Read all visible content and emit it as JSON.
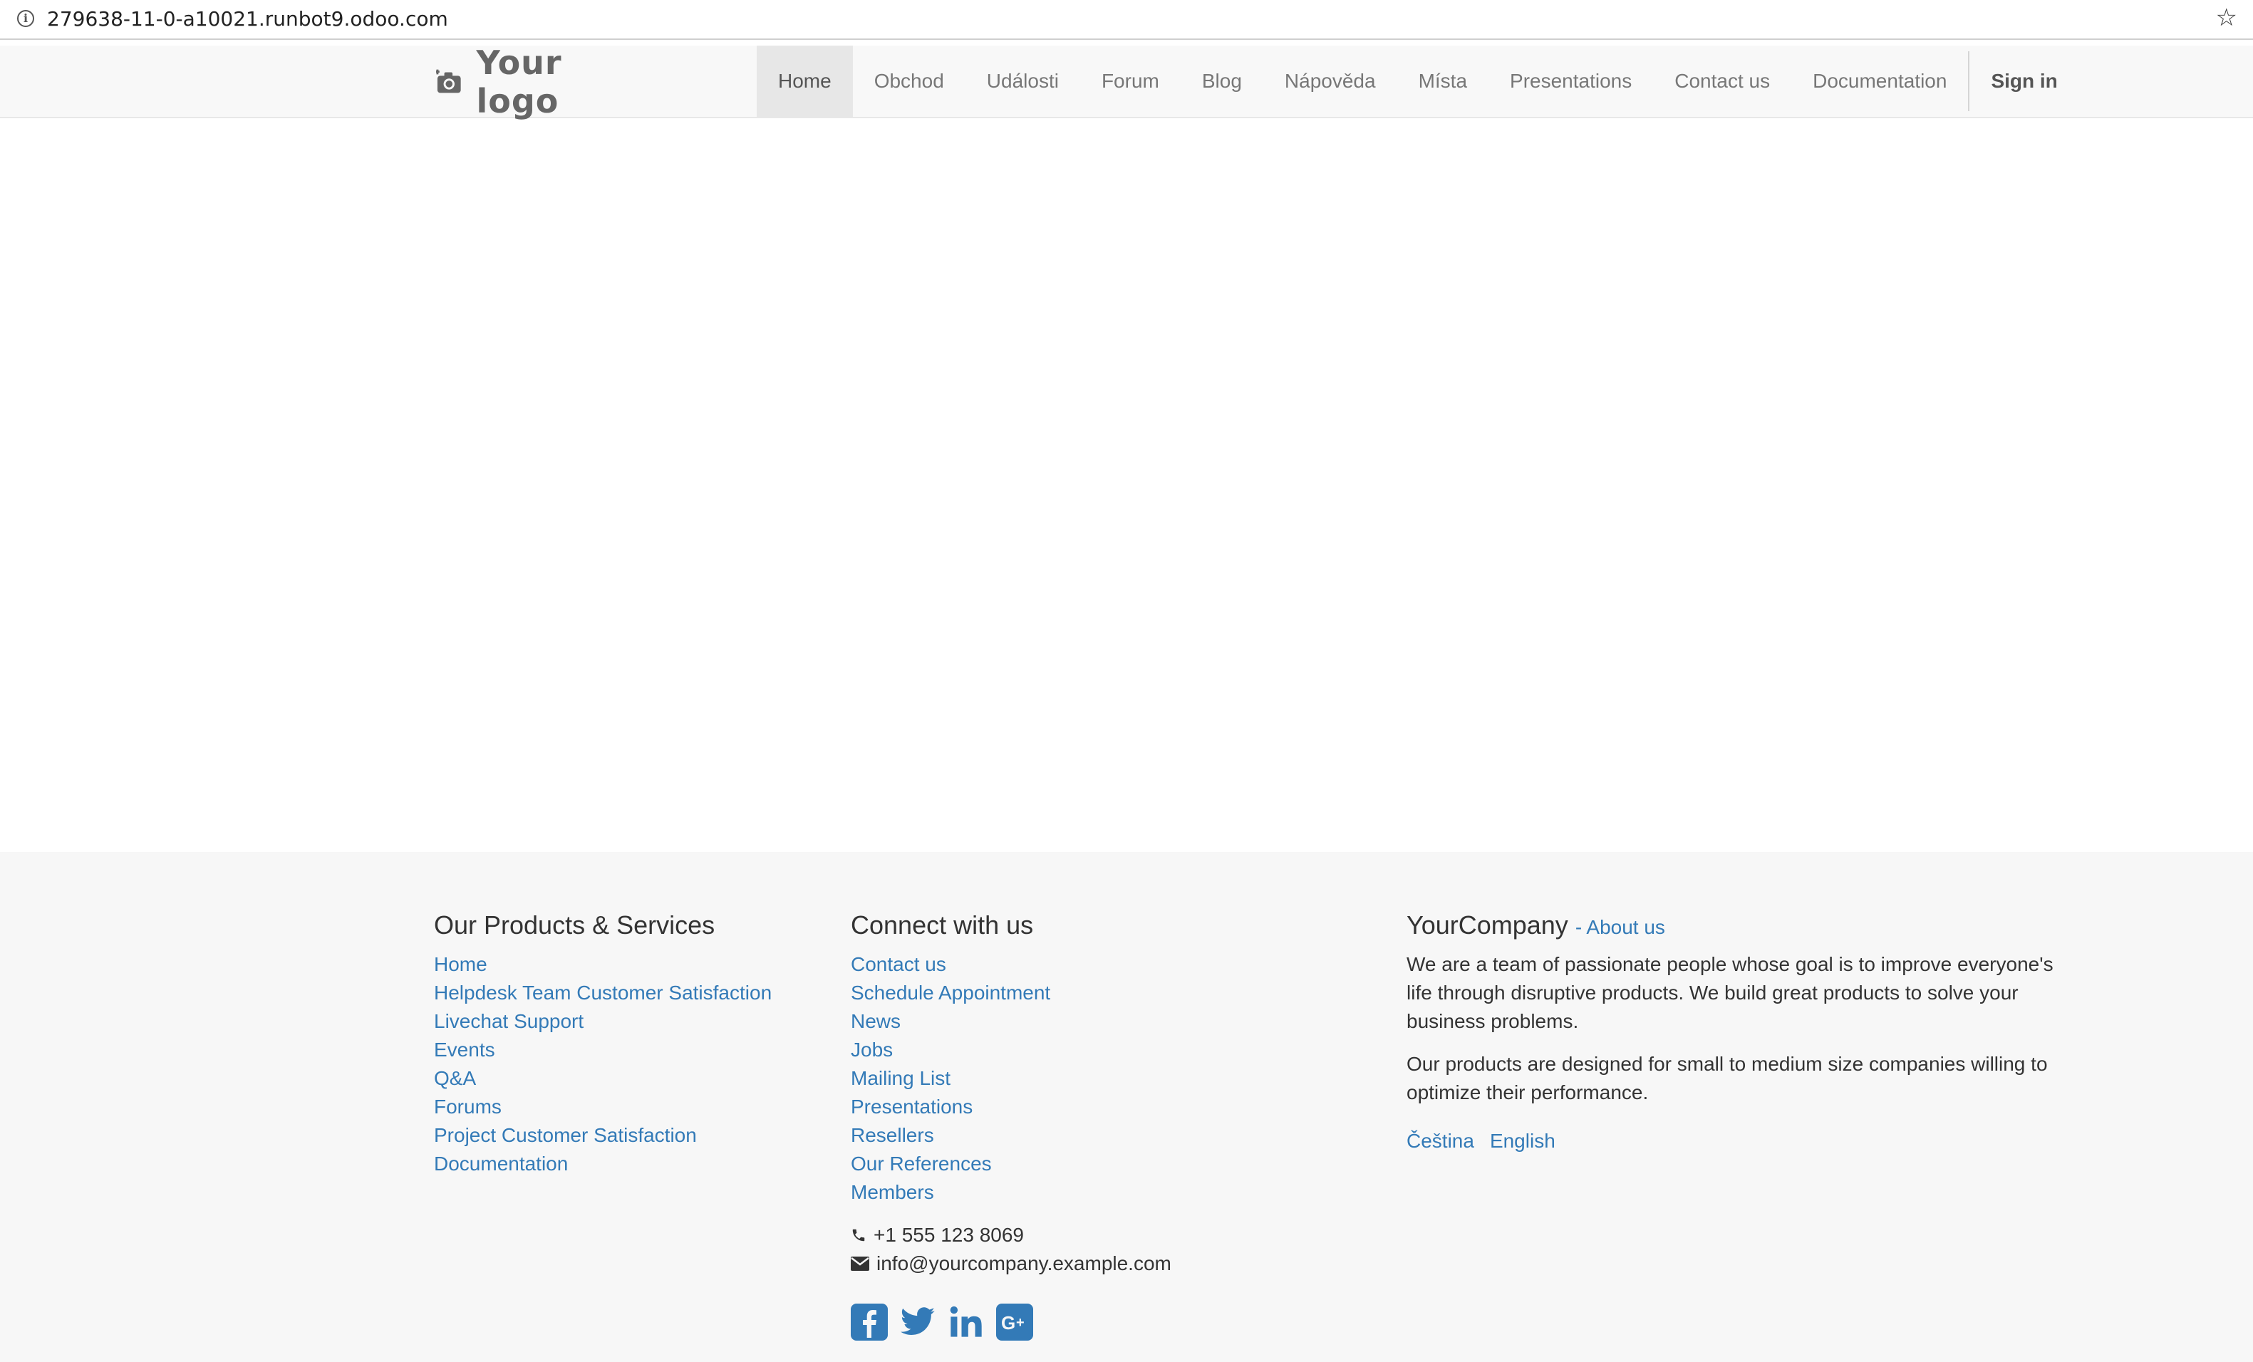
{
  "browser": {
    "url": "279638-11-0-a10021.runbot9.odoo.com"
  },
  "header": {
    "logo_text": "Your logo",
    "nav": [
      {
        "label": "Home",
        "active": true
      },
      {
        "label": "Obchod"
      },
      {
        "label": "Události"
      },
      {
        "label": "Forum"
      },
      {
        "label": "Blog"
      },
      {
        "label": "Nápověda"
      },
      {
        "label": "Místa"
      },
      {
        "label": "Presentations"
      },
      {
        "label": "Contact us"
      },
      {
        "label": "Documentation"
      }
    ],
    "signin_label": "Sign in"
  },
  "footer": {
    "products": {
      "title": "Our Products & Services",
      "links": [
        "Home",
        "Helpdesk Team Customer Satisfaction",
        "Livechat Support",
        "Events",
        "Q&A",
        "Forums",
        "Project Customer Satisfaction",
        "Documentation"
      ]
    },
    "connect": {
      "title": "Connect with us",
      "links": [
        "Contact us",
        "Schedule Appointment",
        "News",
        "Jobs",
        "Mailing List",
        "Presentations",
        "Resellers",
        "Our References",
        "Members"
      ],
      "phone": "+1 555 123 8069",
      "email": "info@yourcompany.example.com",
      "social": [
        "facebook-icon",
        "twitter-icon",
        "linkedin-icon",
        "google-plus-icon"
      ]
    },
    "company": {
      "name": "YourCompany",
      "about_link": "- About us",
      "paragraph1": "We are a team of passionate people whose goal is to improve everyone's life through disruptive products. We build great products to solve your business problems.",
      "paragraph2": "Our products are designed for small to medium size companies willing to optimize their performance.",
      "languages": [
        "Čeština",
        "English"
      ]
    }
  },
  "colors": {
    "link": "#337ab7",
    "header_bg": "#f8f8f8",
    "footer_bg": "#f7f7f7",
    "nav_active_bg": "#e7e7e7"
  }
}
